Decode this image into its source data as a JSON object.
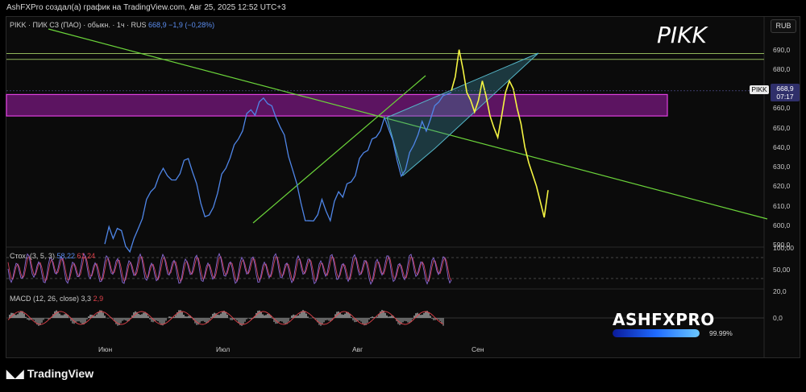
{
  "header": {
    "credit": "AshFXPro создал(а) график на TradingView.com, Авг 25, 2025 12:52 UTC+3"
  },
  "legend": {
    "main": "PIKK · ПИК СЗ (ПАО) · обыкн. · 1ч · RUS",
    "price": "668,9",
    "change": "−1,9 (−0,28%)",
    "stoch_name": "Стох. (3, 5, 3)",
    "stoch_k": "58,22",
    "stoch_d": "61,24",
    "macd_name": "MACD (12, 26, close)",
    "macd_v1": "3,3",
    "macd_v2": "2,9"
  },
  "overlay": {
    "symbol": "PIKK",
    "brand": "ASHFXPRO",
    "progress_pct": "99.99%",
    "progress_value": 0.9999
  },
  "axis": {
    "currency": "RUB",
    "ticks": [
      "690,0",
      "680,0",
      "670,0",
      "660,0",
      "650,0",
      "640,0",
      "630,0",
      "620,0",
      "610,0",
      "600,0",
      "590,0"
    ],
    "stoch_ticks": [
      "100,00",
      "50,00",
      "20,0"
    ],
    "macd_ticks": [
      "0,0"
    ],
    "months": [
      "Июн",
      "Июл",
      "Авг",
      "Сен"
    ]
  },
  "price_tag": {
    "symbol": "PIKK",
    "value": "668,9",
    "time": "07:17"
  },
  "footer": {
    "logo": "TradingView"
  },
  "colors": {
    "price": "#4f86e8",
    "zone": "#e040e0",
    "trend": "#6bd43a",
    "forecast": "#f5f542",
    "wedge": "#55b6c8"
  },
  "chart_data": {
    "type": "line",
    "ylim": [
      590,
      694
    ],
    "series_note": "hourly close prices (approx.)",
    "x_months": [
      "Июн",
      "Июл",
      "Авг",
      "Сен"
    ],
    "price_points": [
      592,
      598,
      594,
      600,
      596,
      590,
      588,
      592,
      599,
      605,
      612,
      618,
      621,
      624,
      630,
      627,
      622,
      624,
      628,
      632,
      635,
      629,
      620,
      612,
      606,
      604,
      610,
      618,
      625,
      630,
      636,
      640,
      645,
      650,
      656,
      660,
      658,
      662,
      666,
      664,
      660,
      656,
      652,
      645,
      636,
      630,
      620,
      612,
      604,
      601,
      603,
      607,
      612,
      608,
      604,
      611,
      618,
      616,
      620,
      623,
      627,
      633,
      638,
      640,
      643,
      646,
      650,
      654,
      650,
      645,
      632,
      626,
      630,
      636,
      642,
      648,
      652,
      649,
      656,
      660,
      664,
      668,
      666,
      668.9
    ],
    "forecast_points": [
      668.9,
      676,
      690,
      680,
      668,
      664,
      658,
      664,
      674,
      666,
      656,
      650,
      645,
      656,
      668,
      674,
      670,
      660,
      652,
      640,
      632,
      626,
      620,
      612,
      604,
      618
    ],
    "resistance_zone": [
      656,
      667
    ],
    "horizontal_levels": [
      688,
      685
    ],
    "stoch_k": 58.22,
    "stoch_d": 61.24,
    "macd": 3.3,
    "macd_signal": 2.9
  }
}
